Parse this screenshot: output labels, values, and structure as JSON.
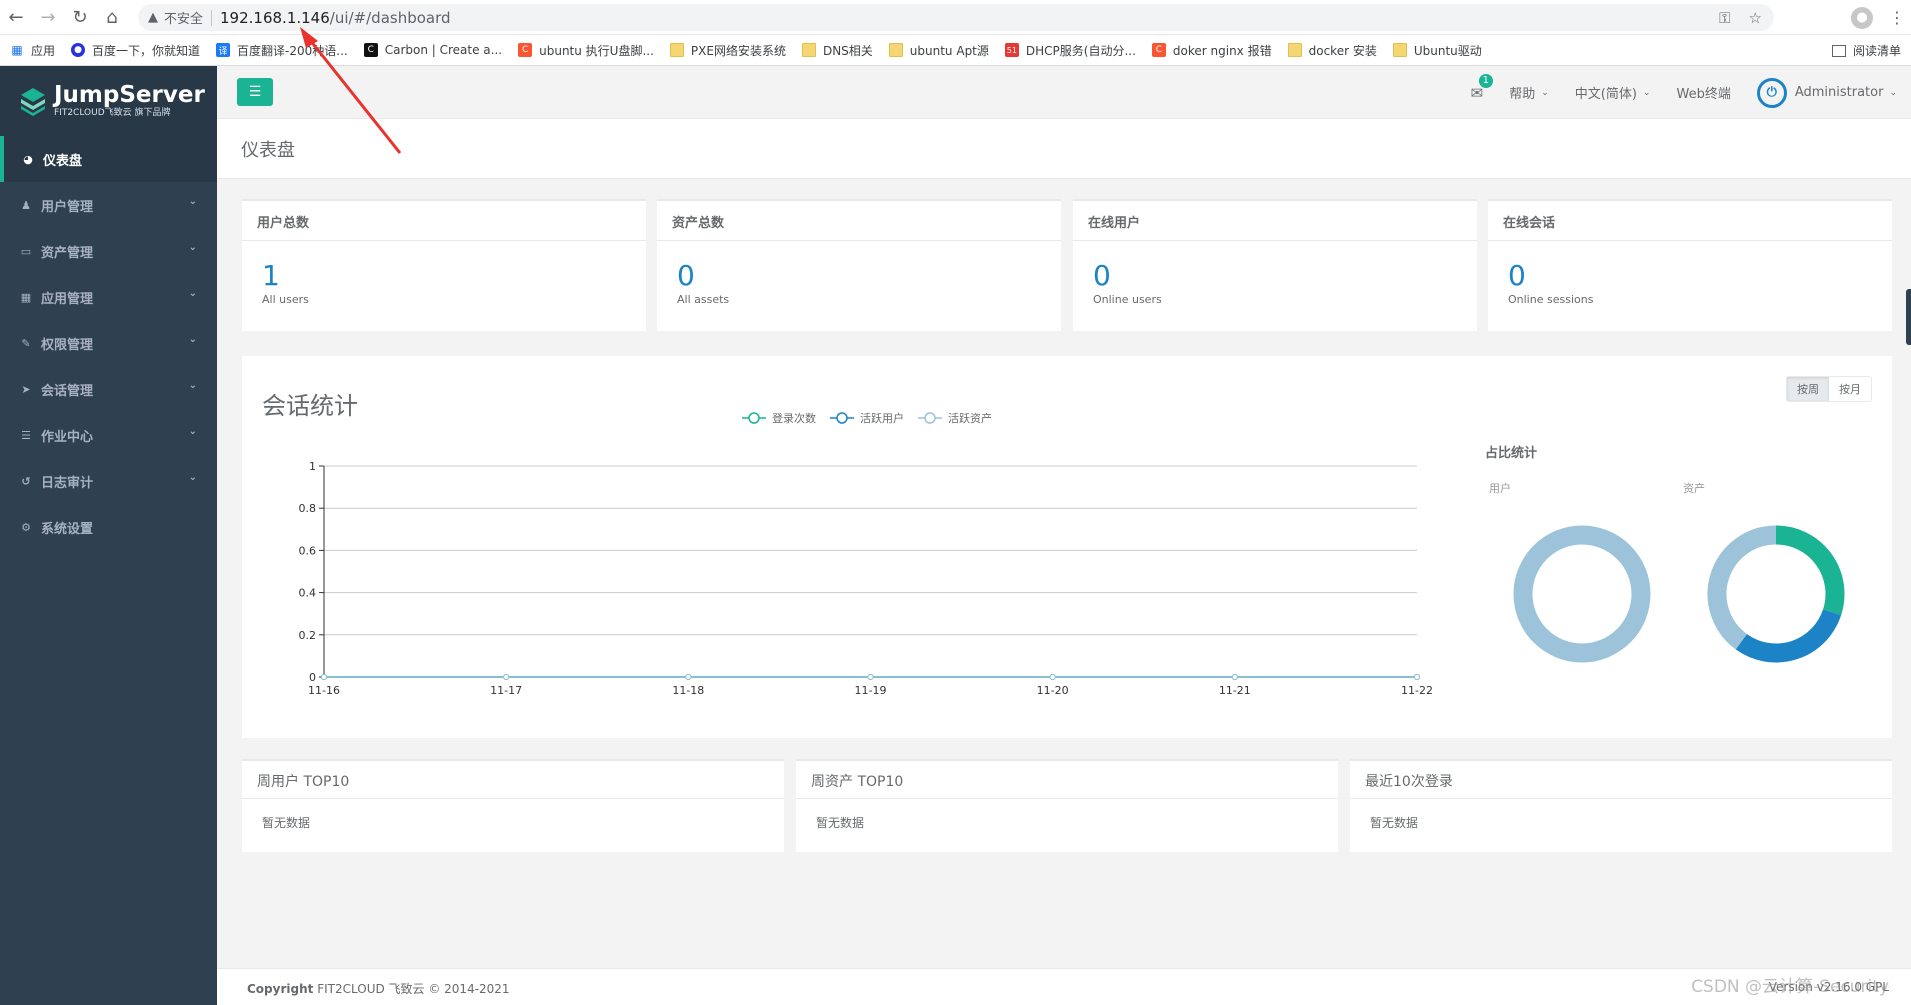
{
  "browser": {
    "insecure_label": "不安全",
    "url_host": "192.168.1.146",
    "url_path": "/ui/#/dashboard"
  },
  "bookmarks": [
    {
      "label": "应用",
      "icon": "apps-grid-icon"
    },
    {
      "label": "百度一下，你就知道",
      "icon": "baidu-paw-icon"
    },
    {
      "label": "百度翻译-200种语...",
      "icon": "fanyi-icon"
    },
    {
      "label": "Carbon | Create a...",
      "icon": "carbon-icon"
    },
    {
      "label": "ubuntu 执行U盘脚...",
      "icon": "csdn-icon"
    },
    {
      "label": "PXE网络安装系统",
      "icon": "folder-icon"
    },
    {
      "label": "DNS相关",
      "icon": "folder-icon"
    },
    {
      "label": "ubuntu Apt源",
      "icon": "folder-icon"
    },
    {
      "label": "DHCP服务(自动分...",
      "icon": "51cto-icon"
    },
    {
      "label": "doker nginx 报错",
      "icon": "csdn-icon"
    },
    {
      "label": "docker 安装",
      "icon": "folder-icon"
    },
    {
      "label": "Ubuntu驱动",
      "icon": "folder-icon"
    }
  ],
  "reading_list": "阅读清单",
  "logo": {
    "name": "JumpServer",
    "tagline": "FIT2CLOUD飞致云 旗下品牌"
  },
  "sidebar": {
    "items": [
      {
        "label": "仪表盘",
        "icon": "dashboard-icon",
        "active": true
      },
      {
        "label": "用户管理",
        "icon": "users-icon"
      },
      {
        "label": "资产管理",
        "icon": "inbox-icon"
      },
      {
        "label": "应用管理",
        "icon": "grid-icon"
      },
      {
        "label": "权限管理",
        "icon": "edit-icon"
      },
      {
        "label": "会话管理",
        "icon": "rocket-icon"
      },
      {
        "label": "作业中心",
        "icon": "list-icon"
      },
      {
        "label": "日志审计",
        "icon": "history-icon"
      },
      {
        "label": "系统设置",
        "icon": "cogs-icon"
      }
    ]
  },
  "topnav": {
    "mail_count": "1",
    "help": "帮助",
    "language": "中文(简体)",
    "web_terminal": "Web终端",
    "user": "Administrator"
  },
  "page_title": "仪表盘",
  "stats": [
    {
      "title": "用户总数",
      "value": "1",
      "sub": "All users"
    },
    {
      "title": "资产总数",
      "value": "0",
      "sub": "All assets"
    },
    {
      "title": "在线用户",
      "value": "0",
      "sub": "Online users"
    },
    {
      "title": "在线会话",
      "value": "0",
      "sub": "Online sessions"
    }
  ],
  "session_panel": {
    "title": "会话统计",
    "toggle_week": "按周",
    "toggle_month": "按月",
    "ratio_title": "占比统计",
    "ratio_user_label": "用户",
    "ratio_asset_label": "资产"
  },
  "chart_data": [
    {
      "type": "line",
      "x": [
        "11-16",
        "11-17",
        "11-18",
        "11-19",
        "11-20",
        "11-21",
        "11-22"
      ],
      "series": [
        {
          "name": "登录次数",
          "values": [
            0,
            0,
            0,
            0,
            0,
            0,
            0
          ],
          "color": "#1ab394"
        },
        {
          "name": "活跃用户",
          "values": [
            0,
            0,
            0,
            0,
            0,
            0,
            0
          ],
          "color": "#1c84c6"
        },
        {
          "name": "活跃资产",
          "values": [
            0,
            0,
            0,
            0,
            0,
            0,
            0
          ],
          "color": "#9cc3da"
        }
      ],
      "ylim": [
        0,
        1
      ],
      "yticks": [
        "0",
        "0.2",
        "0.4",
        "0.6",
        "0.8",
        "1"
      ],
      "grid": true,
      "legend": "top"
    },
    {
      "type": "pie",
      "label": "用户",
      "slices": [
        {
          "value": 1,
          "color": "#9cc3da"
        }
      ]
    },
    {
      "type": "pie",
      "label": "资产",
      "slices": [
        {
          "value": 0.3,
          "color": "#1ab394"
        },
        {
          "value": 0.3,
          "color": "#1c84c6"
        },
        {
          "value": 0.4,
          "color": "#9cc3da"
        }
      ]
    }
  ],
  "lists": [
    {
      "title": "周用户 TOP10",
      "empty": "暂无数据"
    },
    {
      "title": "周资产 TOP10",
      "empty": "暂无数据"
    },
    {
      "title": "最近10次登录",
      "empty": "暂无数据"
    }
  ],
  "footer": {
    "copyright_bold": "Copyright",
    "copyright_rest": "FIT2CLOUD 飞致云 © 2014-2021",
    "version": "Version v2.16.0 GPL"
  },
  "watermark": "CSDN @云计算-Security",
  "colors": {
    "accent": "#1ab394",
    "primary": "#1c84c6",
    "sidebar": "#2f4050",
    "annotation": "#e8322b"
  }
}
